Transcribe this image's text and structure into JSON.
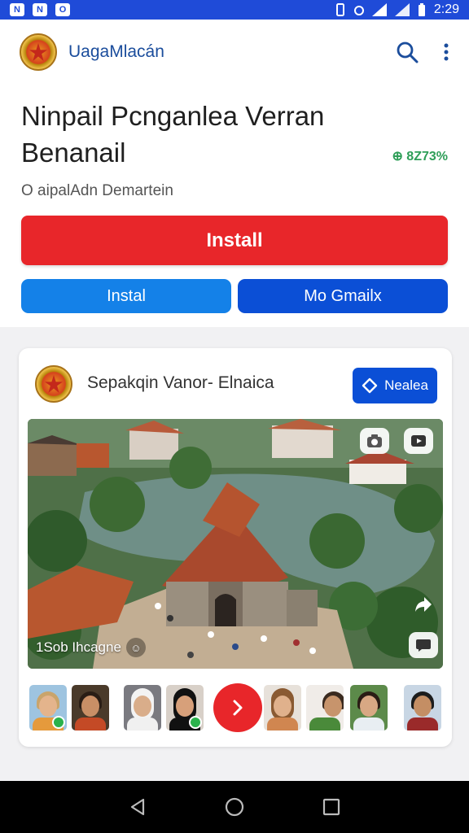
{
  "status_bar": {
    "time": "2:29",
    "notifications": [
      "N",
      "N",
      "O"
    ],
    "bg_color": "#1f4bd8"
  },
  "app_bar": {
    "app_name": "UagaMlacán",
    "icons": [
      "search-icon",
      "more-vert-icon"
    ]
  },
  "header": {
    "title": "Ninpail Pcnganlea Verran Benanail",
    "size": "⊕ 8Z73%",
    "developer": "O aipalAdn Demartein"
  },
  "buttons": {
    "install_label": "Install",
    "instal_label": "Instal",
    "more_label": "Mo Gmailx",
    "install_color": "#e8262a",
    "instal_color": "#1481e8",
    "more_color": "#0b4fd6"
  },
  "card": {
    "title": "Sepakqin Vanor- Elnaica",
    "action_label": "Nealea",
    "photo_caption": "1Sob Ihcagne",
    "caption_icon": "☺",
    "thumbnails": [
      {
        "type": "person",
        "badge": true
      },
      {
        "type": "person",
        "badge": false
      },
      {
        "type": "person",
        "badge": false
      },
      {
        "type": "person",
        "badge": true
      },
      {
        "type": "person",
        "badge": false
      },
      {
        "type": "person",
        "badge": false
      },
      {
        "type": "person",
        "badge": false
      },
      {
        "type": "person",
        "badge": false
      }
    ]
  },
  "nav_bar": {
    "icons": [
      "back-icon",
      "home-icon",
      "recents-icon"
    ]
  }
}
